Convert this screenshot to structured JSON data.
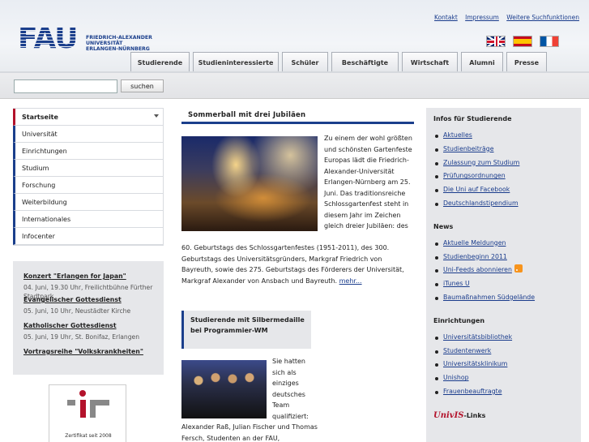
{
  "header": {
    "toplinks": [
      "Kontakt",
      "Impressum",
      "Weitere Suchfunktionen"
    ],
    "logo": {
      "letters": "FAU",
      "lines": [
        "FRIEDRICH-ALEXANDER",
        "UNIVERSITÄT",
        "ERLANGEN-NÜRNBERG"
      ]
    },
    "flags": [
      "english-flag-icon",
      "spanish-flag-icon",
      "french-flag-icon"
    ],
    "tabs": [
      "Studierende",
      "Studieninteressierte",
      "Schüler",
      "Beschäftigte",
      "Wirtschaft",
      "Alumni",
      "Presse"
    ]
  },
  "search": {
    "placeholder": "",
    "button_label": "suchen"
  },
  "leftnav": {
    "items": [
      "Startseite",
      "Universität",
      "Einrichtungen",
      "Studium",
      "Forschung",
      "Weiterbildung",
      "Internationales",
      "Infocenter"
    ]
  },
  "events": [
    {
      "title": "Konzert \"Erlangen for Japan\"",
      "text": "04. Juni, 19.30 Uhr, Freilichtbühne Fürther Stadtpark"
    },
    {
      "title": "Evangelischer Gottesdienst",
      "text": "05. Juni, 10 Uhr, Neustädter Kirche"
    },
    {
      "title": "Katholischer Gottesdienst",
      "text": "05. Juni, 19 Uhr, St. Bonifaz, Erlangen"
    },
    {
      "title": "Vortragsreihe \"Volkskrankheiten\"",
      "text": ""
    }
  ],
  "certificate": {
    "caption": "Zertifikat seit 2008"
  },
  "main": {
    "article1": {
      "title": "Sommerball mit drei Jubiläen",
      "text_right": "Zu einem der wohl größten und schönsten Gartenfeste Europas lädt die Friedrich-Alexander-Universität Erlangen-Nürnberg am 25. Juni. Das traditionsreiche Schlossgartenfest steht in diesem Jahr im Zeichen gleich dreier Jubiläen: des",
      "text_full": "60. Geburtstags des Schlossgartenfestes (1951-2011), des 300. Geburtstags des Universitätsgründers, Markgraf Friedrich von Bayreuth, sowie des 275. Geburtstags des Förderers der Universität, Markgraf Alexander von Ansbach und Bayreuth.",
      "more": "mehr..."
    },
    "article2": {
      "title": "Studierende mit Silbermedaille bei Programmier-WM",
      "text_right": "Sie hatten sich als einziges deutsches Team qualifiziert:",
      "text_full": "Alexander Raß, Julian Fischer und Thomas Fersch, Studenten an der FAU,"
    }
  },
  "right": {
    "sections": [
      {
        "heading": "Infos für Studierende",
        "items": [
          "Aktuelles",
          "Studienbeiträge",
          "Zulassung zum Studium",
          "Prüfungsordnungen",
          "Die Uni auf Facebook",
          "Deutschlandstipendium"
        ]
      },
      {
        "heading": "News",
        "items": [
          "Aktuelle Meldungen",
          "Studienbeginn 2011",
          "Uni-Feeds abonnieren",
          "iTunes U",
          "Baumaßnahmen Südgelände"
        ]
      },
      {
        "heading": "Einrichtungen",
        "items": [
          "Universitätsbibliothek",
          "Studentenwerk",
          "Universitätsklinikum",
          "Unishop",
          "Frauenbeauftragte"
        ]
      }
    ],
    "univis": {
      "brand": "UnivIS",
      "suffix": "-Links"
    }
  }
}
